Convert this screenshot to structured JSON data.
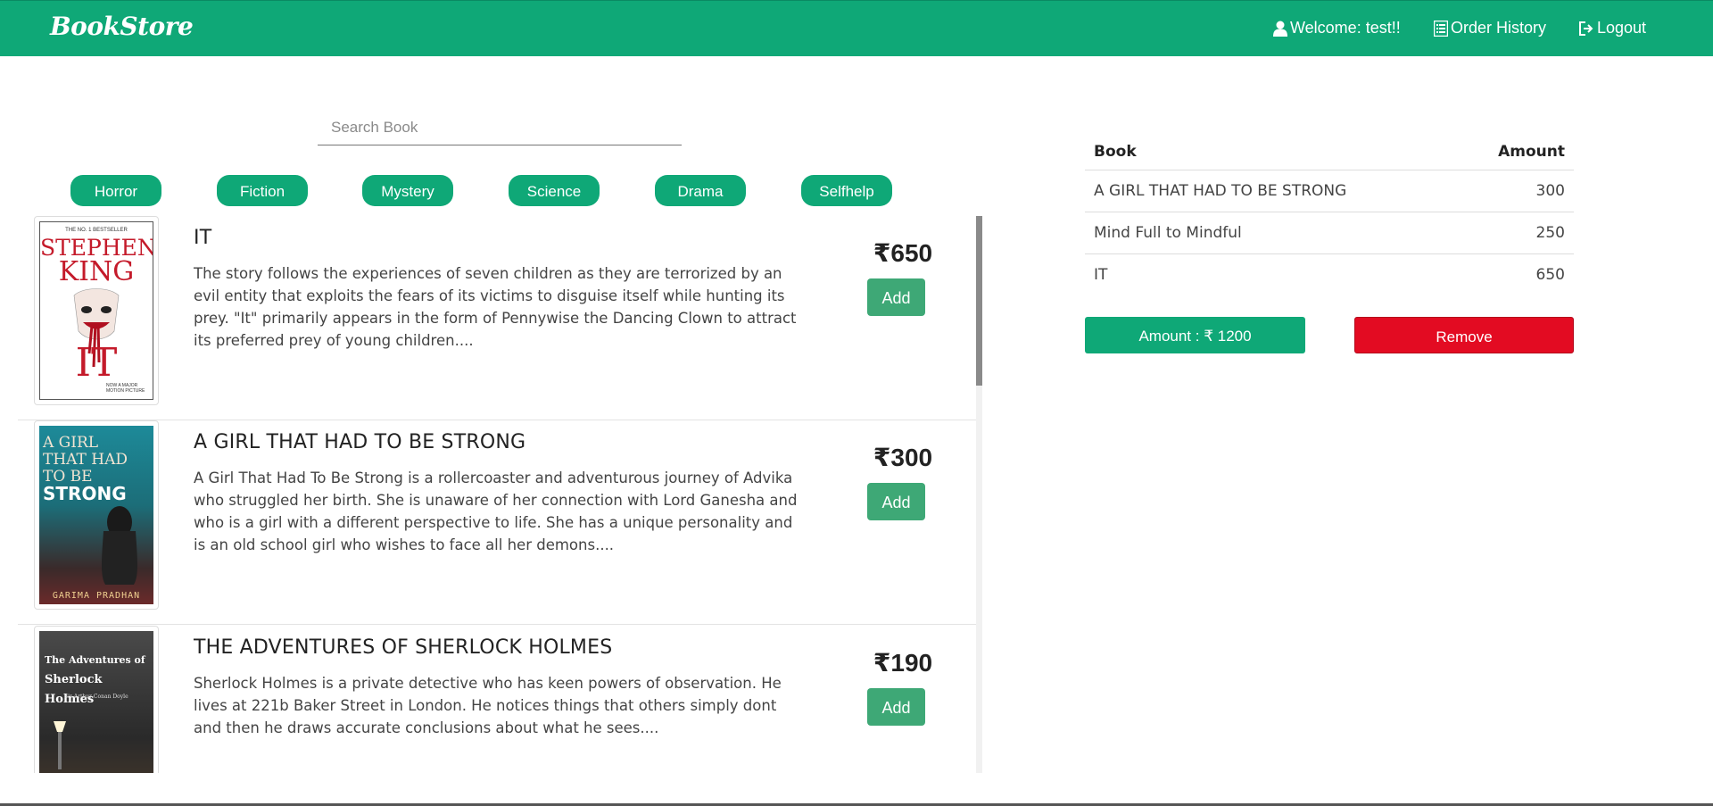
{
  "app": {
    "brand": "BookStore"
  },
  "nav": {
    "welcome": "Welcome: test!!",
    "order_history": "Order History",
    "logout": "Logout"
  },
  "search": {
    "placeholder": "Search Book"
  },
  "categories": [
    "Horror",
    "Fiction",
    "Mystery",
    "Science",
    "Drama",
    "Selfhelp"
  ],
  "books": [
    {
      "title": "IT",
      "description": "The story follows the experiences of seven children as they are terrorized by an evil entity that exploits the fears of its victims to disguise itself while hunting its prey. \"It\" primarily appears in the form of Pennywise the Dancing Clown to attract its preferred prey of young children....",
      "price": "₹650",
      "add_label": "Add",
      "cover": {
        "top": "THE NO. 1 BESTSELLER",
        "author1": "STEPHEN",
        "author2": "KING",
        "title": "IT",
        "tagline": "NOW A MAJOR MOTION PICTURE"
      }
    },
    {
      "title": "A GIRL THAT HAD TO BE STRONG",
      "description": "A Girl That Had To Be Strong is a rollercoaster and adventurous journey of Advika who struggled her birth. She is unaware of her connection with Lord Ganesha and who is a girl with a different perspective to life. She has a unique personality and is an old school girl who wishes to face all her demons....",
      "price": "₹300",
      "add_label": "Add",
      "cover": {
        "line1": "A GIRL",
        "line2": "THAT HAD",
        "line3": "TO BE",
        "line4": "STRONG",
        "author": "GARIMA PRADHAN"
      }
    },
    {
      "title": "THE ADVENTURES OF SHERLOCK HOLMES",
      "description": "Sherlock Holmes is a private detective who has keen powers of observation. He lives at 221b Baker Street in London. He notices things that others simply dont and then he draws accurate conclusions about what he sees....",
      "price": "₹190",
      "add_label": "Add",
      "cover": {
        "line1": "The Adventures of",
        "line2": "Sherlock Holmes",
        "author": "Sir Arthur Conan Doyle"
      }
    }
  ],
  "cart": {
    "headers": {
      "book": "Book",
      "amount": "Amount"
    },
    "items": [
      {
        "book": "A GIRL THAT HAD TO BE STRONG",
        "amount": "300"
      },
      {
        "book": "Mind Full to Mindful",
        "amount": "250"
      },
      {
        "book": "IT",
        "amount": "650"
      }
    ],
    "total_label": "Amount : ₹ 1200",
    "remove_label": "Remove"
  },
  "colors": {
    "primary": "#0fa877",
    "add_button": "#3ea876",
    "remove": "#e30b22"
  }
}
